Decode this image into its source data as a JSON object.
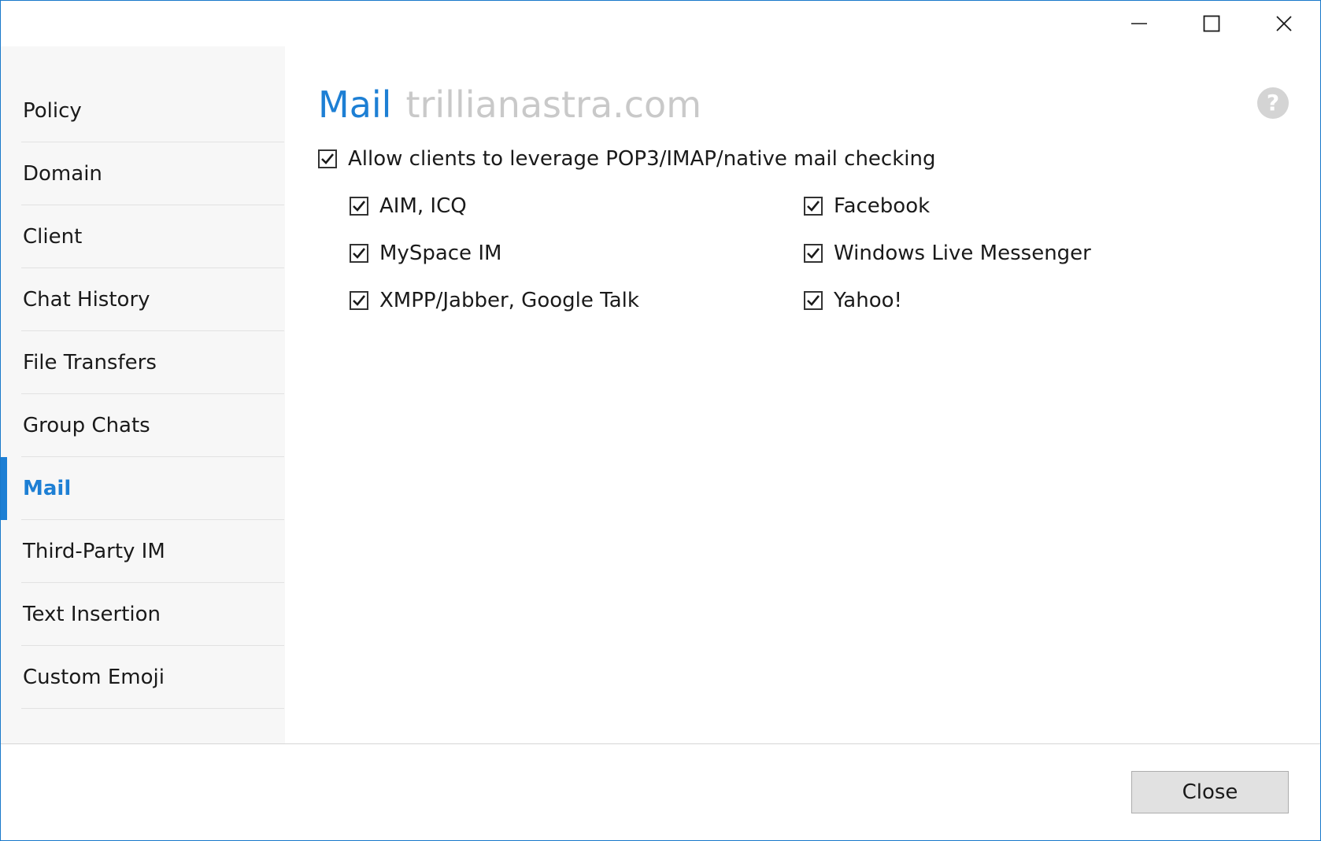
{
  "window": {
    "caption_buttons": {
      "minimize_icon": "minimize-icon",
      "maximize_icon": "maximize-icon",
      "close_icon": "close-icon"
    }
  },
  "sidebar": {
    "items": [
      {
        "label": "Policy"
      },
      {
        "label": "Domain"
      },
      {
        "label": "Client"
      },
      {
        "label": "Chat History"
      },
      {
        "label": "File Transfers"
      },
      {
        "label": "Group Chats"
      },
      {
        "label": "Mail",
        "active": true
      },
      {
        "label": "Third-Party IM"
      },
      {
        "label": "Text Insertion"
      },
      {
        "label": "Custom Emoji"
      }
    ]
  },
  "main": {
    "section_title": "Mail",
    "domain": "trillianastra.com",
    "help_label": "?",
    "master_option": {
      "label": "Allow clients to leverage POP3/IMAP/native mail checking",
      "checked": true
    },
    "options": [
      {
        "label": "AIM, ICQ",
        "checked": true
      },
      {
        "label": "Facebook",
        "checked": true
      },
      {
        "label": "MySpace IM",
        "checked": true
      },
      {
        "label": "Windows Live Messenger",
        "checked": true
      },
      {
        "label": "XMPP/Jabber, Google Talk",
        "checked": true
      },
      {
        "label": "Yahoo!",
        "checked": true
      }
    ]
  },
  "footer": {
    "close_label": "Close"
  },
  "colors": {
    "accent": "#1d7fd4",
    "domain_text": "#c9c9c9",
    "sidebar_bg": "#f7f7f7",
    "border": "#1979ca"
  }
}
